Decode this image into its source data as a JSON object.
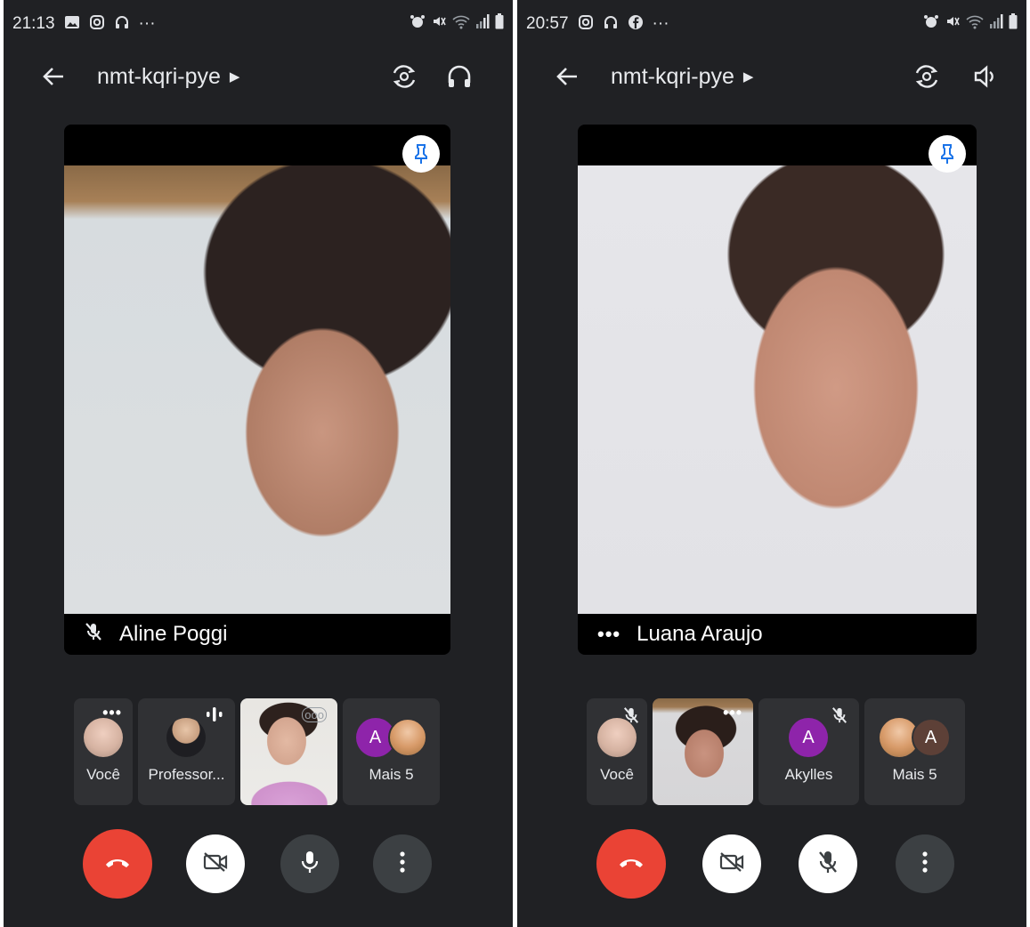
{
  "colors": {
    "app_background": "#202124",
    "end_call": "#ea4335",
    "pin_accent": "#1a73e8",
    "avatar_purple": "#8e24aa",
    "avatar_brown": "#5d4037"
  },
  "left": {
    "status": {
      "time": "21:13",
      "overflow": "···"
    },
    "meeting_code": "nmt-kqri-pye",
    "main_speaker": {
      "name": "Aline Poggi",
      "muted": true
    },
    "filmstrip": [
      {
        "label": "Você"
      },
      {
        "label": "Professor..."
      },
      {
        "label": ""
      },
      {
        "label": "Mais 5",
        "initial": "A"
      }
    ],
    "top_icons": [
      "back-arrow-icon",
      "camera-switch-icon",
      "headphones-icon"
    ],
    "controls": [
      "end-call",
      "camera-off",
      "microphone-on",
      "more-options"
    ]
  },
  "right": {
    "status": {
      "time": "20:57",
      "overflow": "···"
    },
    "meeting_code": "nmt-kqri-pye",
    "main_speaker": {
      "name": "Luana Araujo",
      "muted": false
    },
    "filmstrip": [
      {
        "label": "Você"
      },
      {
        "label": ""
      },
      {
        "label": "Akylles",
        "initial": "A"
      },
      {
        "label": "Mais 5",
        "initial": "A"
      }
    ],
    "top_icons": [
      "back-arrow-icon",
      "camera-switch-icon",
      "speaker-icon"
    ],
    "controls": [
      "end-call",
      "camera-off",
      "microphone-off",
      "more-options"
    ]
  }
}
